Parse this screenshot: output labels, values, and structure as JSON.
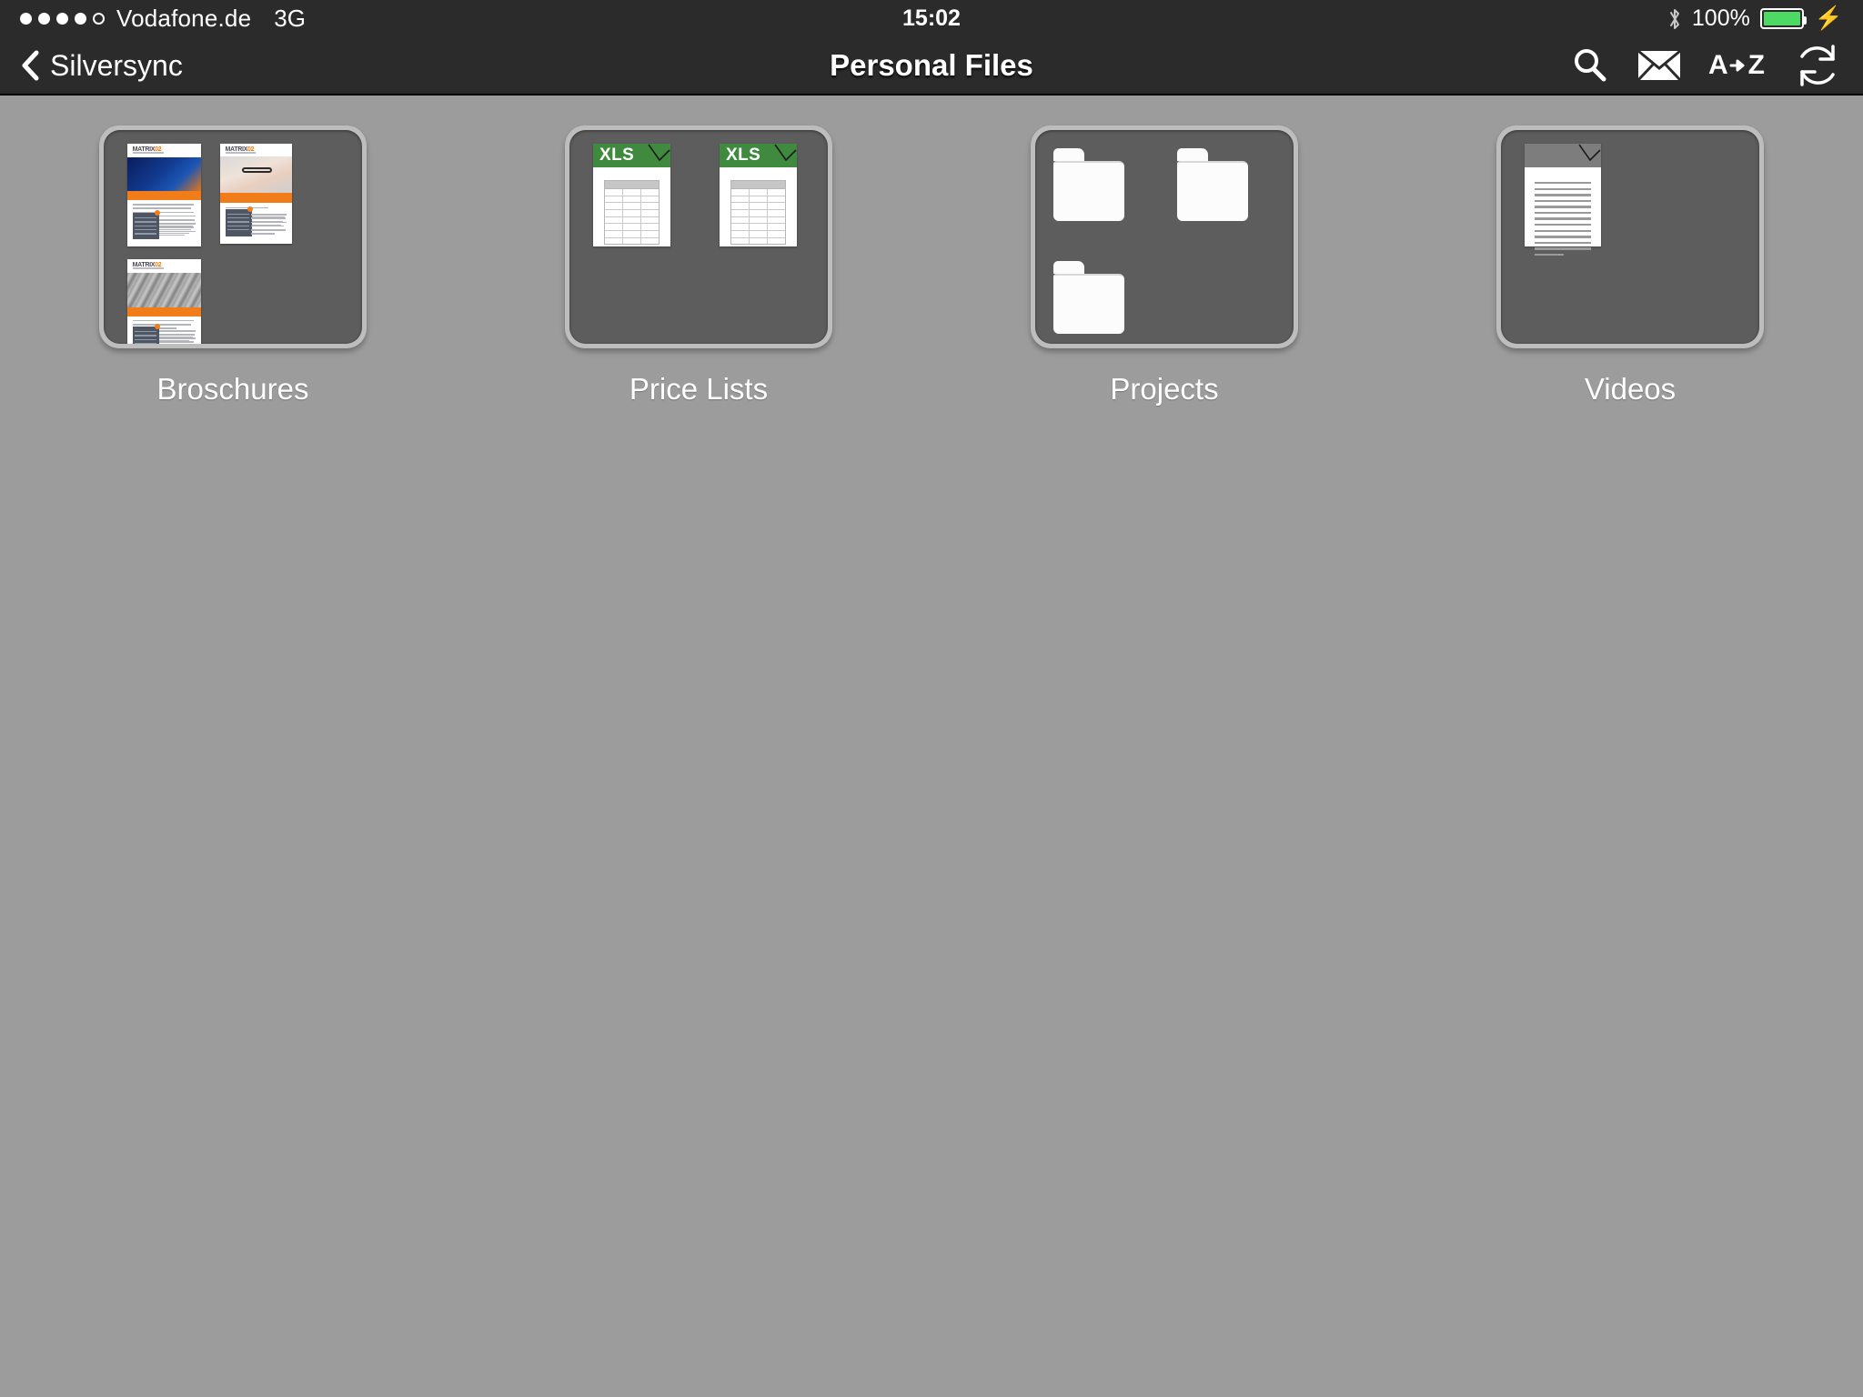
{
  "status_bar": {
    "signal_dots_total": 5,
    "signal_dots_filled": 4,
    "carrier": "Vodafone.de",
    "network": "3G",
    "time": "15:02",
    "battery_percent": "100%",
    "battery_level": 100,
    "battery_color": "#4cd964",
    "bluetooth_icon": "bluetooth-icon",
    "charging_icon": "lightning-bolt-icon",
    "background": "#2b2b2b"
  },
  "nav_bar": {
    "back_icon": "chevron-left-icon",
    "back_label": "Silversync",
    "title": "Personal Files",
    "actions": [
      {
        "name": "search-icon",
        "label": "Search"
      },
      {
        "name": "mail-icon",
        "label": "Mail"
      },
      {
        "name": "sort-az-icon",
        "label": "A",
        "label2": "Z",
        "arrow": "➜"
      },
      {
        "name": "refresh-sync-icon",
        "label": "Sync"
      }
    ],
    "background": "#2b2b2b"
  },
  "page": {
    "background": "#9c9c9c",
    "tile_frame_color": "#bdbdbd",
    "tile_inner_color": "#5d5d5d",
    "accent_orange": "#f07d1a",
    "xls_green": "#3f8a3f"
  },
  "folders": [
    {
      "name": "Broschures",
      "content_type": "brochure-previews",
      "item_count": 3,
      "documents": [
        {
          "title": "MATRIX",
          "accent": "#f07800",
          "photo": "blue-building-night"
        },
        {
          "title": "MATRIX",
          "accent": "#f07800",
          "photo": "woman-with-glasses"
        },
        {
          "title": "MATRIX",
          "accent": "#f07800",
          "photo": "grey-architecture"
        }
      ]
    },
    {
      "name": "Price Lists",
      "content_type": "xls-documents",
      "item_count": 2,
      "documents": [
        {
          "file_type": "XLS"
        },
        {
          "file_type": "XLS"
        }
      ]
    },
    {
      "name": "Projects",
      "content_type": "folders",
      "item_count": 3,
      "documents": [
        {
          "file_type": "folder"
        },
        {
          "file_type": "folder"
        },
        {
          "file_type": "folder"
        }
      ]
    },
    {
      "name": "Videos",
      "content_type": "documents",
      "item_count": 1,
      "documents": [
        {
          "file_type": "document"
        }
      ]
    }
  ]
}
